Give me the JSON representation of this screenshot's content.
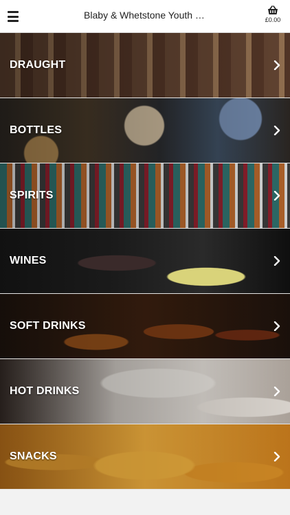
{
  "header": {
    "title": "Blaby & Whetstone Youth …",
    "basket_total": "£0.00",
    "icons": {
      "menu": "hamburger-menu-icon",
      "basket": "shopping-basket-icon"
    }
  },
  "categories": [
    {
      "label": "DRAUGHT",
      "icon": "chevron-right-icon"
    },
    {
      "label": "BOTTLES",
      "icon": "chevron-right-icon"
    },
    {
      "label": "SPIRITS",
      "icon": "chevron-right-icon"
    },
    {
      "label": "WINES",
      "icon": "chevron-right-icon"
    },
    {
      "label": "SOFT DRINKS",
      "icon": "chevron-right-icon"
    },
    {
      "label": "HOT DRINKS",
      "icon": "chevron-right-icon"
    },
    {
      "label": "SNACKS",
      "icon": "chevron-right-icon"
    }
  ],
  "colors": {
    "header_bg": "#ffffff",
    "page_bg": "#f2f2f2",
    "text_dark": "#222222",
    "category_text": "#ffffff"
  }
}
